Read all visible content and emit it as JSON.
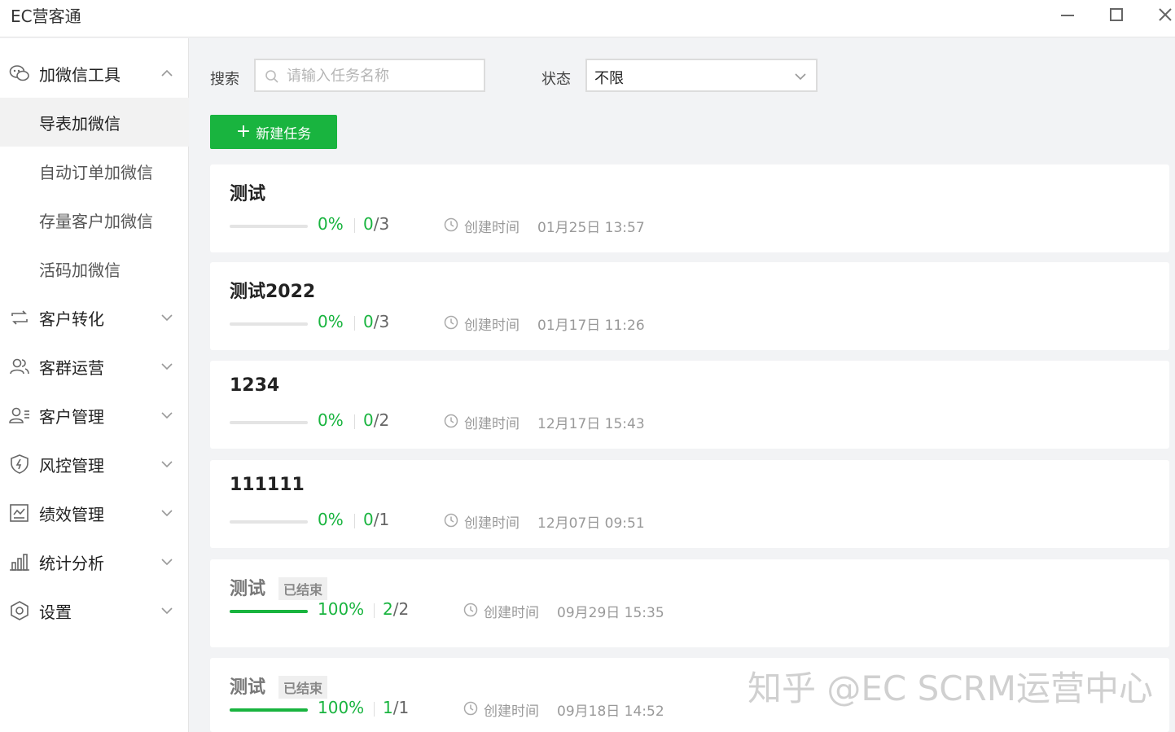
{
  "window": {
    "title": "EC营客通"
  },
  "sidebar": {
    "groups": [
      {
        "label": "加微信工具",
        "icon": "wechat-icon",
        "expanded": true
      },
      {
        "label": "客户转化",
        "icon": "refresh-icon"
      },
      {
        "label": "客群运营",
        "icon": "group-icon"
      },
      {
        "label": "客户管理",
        "icon": "customer-list-icon"
      },
      {
        "label": "风控管理",
        "icon": "shield-icon"
      },
      {
        "label": "绩效管理",
        "icon": "chart-box-icon"
      },
      {
        "label": "统计分析",
        "icon": "bar-chart-icon"
      },
      {
        "label": "设置",
        "icon": "gear-icon"
      }
    ],
    "sub_items": [
      {
        "label": "导表加微信",
        "active": true
      },
      {
        "label": "自动订单加微信"
      },
      {
        "label": "存量客户加微信"
      },
      {
        "label": "活码加微信"
      }
    ]
  },
  "filters": {
    "search_label": "搜索",
    "search_placeholder": "请输入任务名称",
    "status_label": "状态",
    "status_value": "不限"
  },
  "new_task_label": "新建任务",
  "time_label": "创建时间",
  "ended_label": "已结束",
  "tasks": [
    {
      "name": "测试",
      "percent": "0%",
      "done": "0",
      "total": "/3",
      "progress": 0,
      "time": "01月25日 13:57",
      "ended": false
    },
    {
      "name": "测试2022",
      "percent": "0%",
      "done": "0",
      "total": "/3",
      "progress": 0,
      "time": "01月17日 11:26",
      "ended": false
    },
    {
      "name": "1234",
      "percent": "0%",
      "done": "0",
      "total": "/2",
      "progress": 0,
      "time": "12月17日 15:43",
      "ended": false
    },
    {
      "name": "111111",
      "percent": "0%",
      "done": "0",
      "total": "/1",
      "progress": 0,
      "time": "12月07日 09:51",
      "ended": false
    },
    {
      "name": "测试",
      "percent": "100%",
      "done": "2",
      "total": "/2",
      "progress": 1,
      "time": "09月29日 15:35",
      "ended": true
    },
    {
      "name": "测试",
      "percent": "100%",
      "done": "1",
      "total": "/1",
      "progress": 1,
      "time": "09月18日 14:52",
      "ended": true
    }
  ],
  "watermark": "知乎 @EC SCRM运营中心",
  "colors": {
    "accent": "#19b43f"
  }
}
